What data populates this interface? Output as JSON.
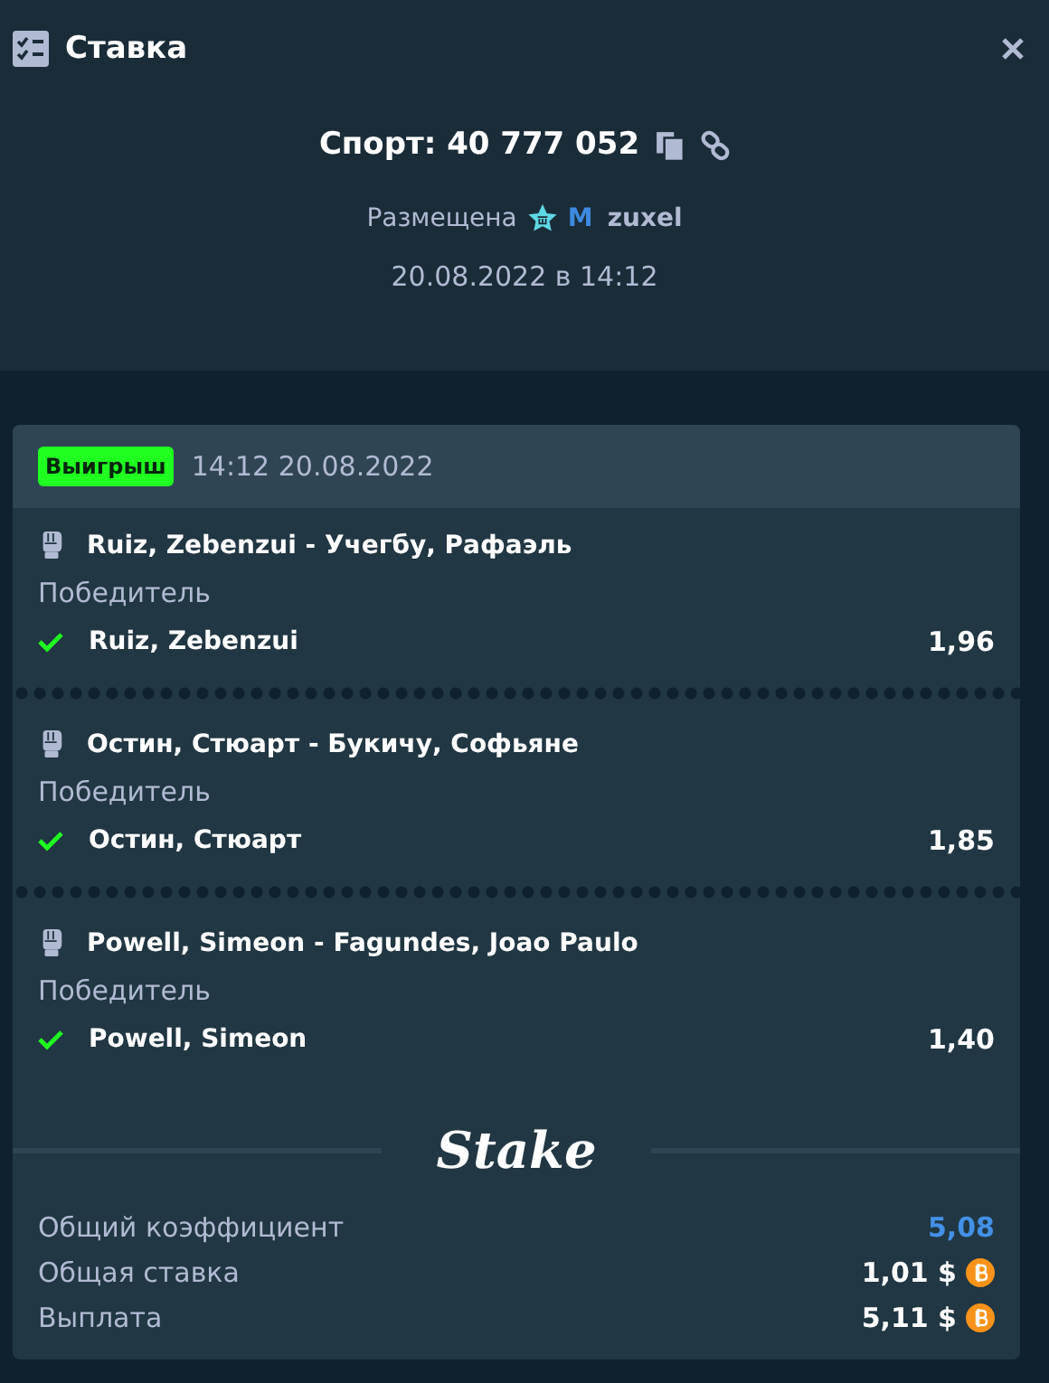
{
  "window": {
    "title": "Ставка"
  },
  "bet": {
    "title": "Спорт: 40 777 052",
    "placed_label": "Размещена",
    "rank": "M",
    "user": "zuxel",
    "date": "20.08.2022 в 14:12"
  },
  "card": {
    "status": {
      "label": "Выигрыш",
      "kind": "win"
    },
    "time": "14:12 20.08.2022"
  },
  "legs": [
    {
      "event": "Ruiz, Zebenzui - Учегбу, Рафаэль",
      "market": "Победитель",
      "pick": "Ruiz, Zebenzui",
      "odds": "1,96",
      "won": true
    },
    {
      "event": "Остин, Стюарт - Букичу, Софьяне",
      "market": "Победитель",
      "pick": "Остин, Стюарт",
      "odds": "1,85",
      "won": true
    },
    {
      "event": "Powell, Simeon - Fagundes, Joao Paulo",
      "market": "Победитель",
      "pick": "Powell, Simeon",
      "odds": "1,40",
      "won": true
    }
  ],
  "logo": "Stake",
  "summary": [
    {
      "label": "Общий коэффициент",
      "value": "5,08",
      "kind": "odds"
    },
    {
      "label": "Общая ставка",
      "value": "1,01 $",
      "kind": "amount"
    },
    {
      "label": "Выплата",
      "value": "5,11 $",
      "kind": "amount"
    }
  ]
}
